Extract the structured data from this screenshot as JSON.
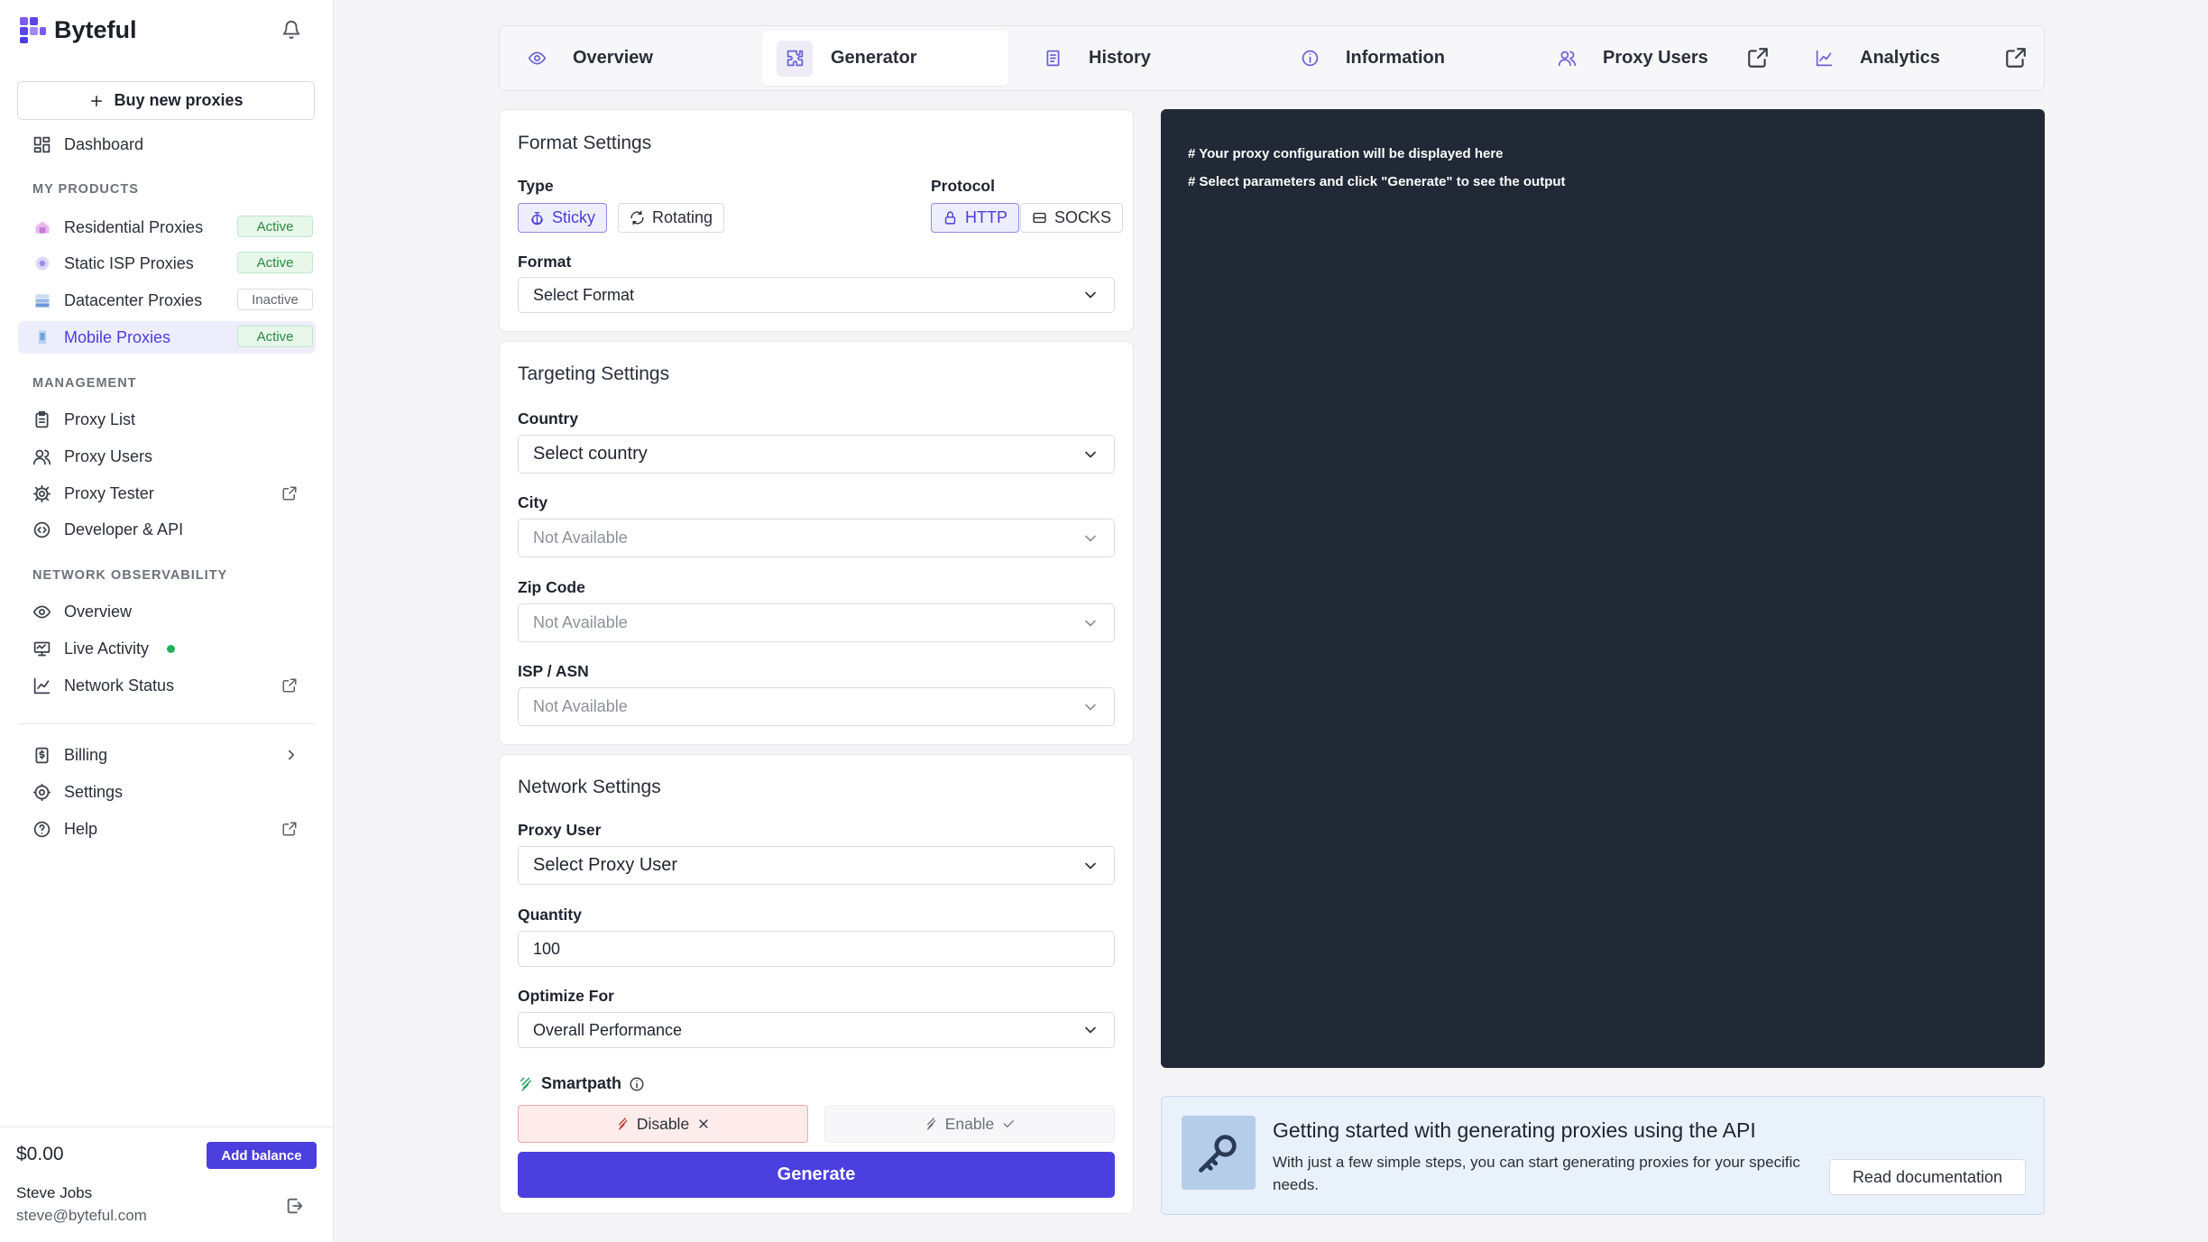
{
  "brand": {
    "name": "Byteful"
  },
  "sidebar": {
    "buy_label": "Buy new proxies",
    "dashboard": "Dashboard",
    "my_products_title": "MY PRODUCTS",
    "products": [
      {
        "label": "Residential Proxies",
        "status": "Active"
      },
      {
        "label": "Static ISP Proxies",
        "status": "Active"
      },
      {
        "label": "Datacenter Proxies",
        "status": "Inactive"
      },
      {
        "label": "Mobile Proxies",
        "status": "Active"
      }
    ],
    "management_title": "MANAGEMENT",
    "management": [
      {
        "label": "Proxy List"
      },
      {
        "label": "Proxy Users"
      },
      {
        "label": "Proxy Tester"
      },
      {
        "label": "Developer & API"
      }
    ],
    "observability_title": "NETWORK OBSERVABILITY",
    "observability": [
      {
        "label": "Overview"
      },
      {
        "label": "Live Activity"
      },
      {
        "label": "Network Status"
      }
    ],
    "bottom": [
      {
        "label": "Billing"
      },
      {
        "label": "Settings"
      },
      {
        "label": "Help"
      }
    ],
    "balance": "$0.00",
    "add_balance": "Add balance",
    "user_name": "Steve Jobs",
    "user_email": "steve@byteful.com"
  },
  "tabs": [
    {
      "label": "Overview"
    },
    {
      "label": "Generator"
    },
    {
      "label": "History"
    },
    {
      "label": "Information"
    },
    {
      "label": "Proxy Users"
    },
    {
      "label": "Analytics"
    }
  ],
  "format_settings": {
    "title": "Format Settings",
    "type_label": "Type",
    "type_options": [
      "Sticky",
      "Rotating"
    ],
    "protocol_label": "Protocol",
    "protocol_options": [
      "HTTP",
      "SOCKS"
    ],
    "format_label": "Format",
    "format_value": "Select Format"
  },
  "targeting_settings": {
    "title": "Targeting Settings",
    "country_label": "Country",
    "country_value": "Select country",
    "city_label": "City",
    "city_value": "Not Available",
    "zip_label": "Zip Code",
    "zip_value": "Not Available",
    "isp_label": "ISP / ASN",
    "isp_value": "Not Available"
  },
  "network_settings": {
    "title": "Network Settings",
    "proxy_user_label": "Proxy User",
    "proxy_user_value": "Select Proxy User",
    "quantity_label": "Quantity",
    "quantity_value": "100",
    "optimize_label": "Optimize For",
    "optimize_value": "Overall Performance",
    "smartpath_label": "Smartpath",
    "disable_label": "Disable",
    "enable_label": "Enable",
    "generate_label": "Generate"
  },
  "output": {
    "lines": [
      "# Your proxy configuration will be displayed here",
      "# Select parameters and click \"Generate\" to see the output"
    ]
  },
  "api_card": {
    "title": "Getting started with generating proxies using the API",
    "description": "With just a few simple steps, you can start generating proxies for your specific needs.",
    "button": "Read documentation"
  },
  "colors": {
    "accent": "#4b3fe0",
    "active_badge": "#2b8a3e",
    "output_bg": "#202935",
    "live_dot": "#22b15a"
  }
}
